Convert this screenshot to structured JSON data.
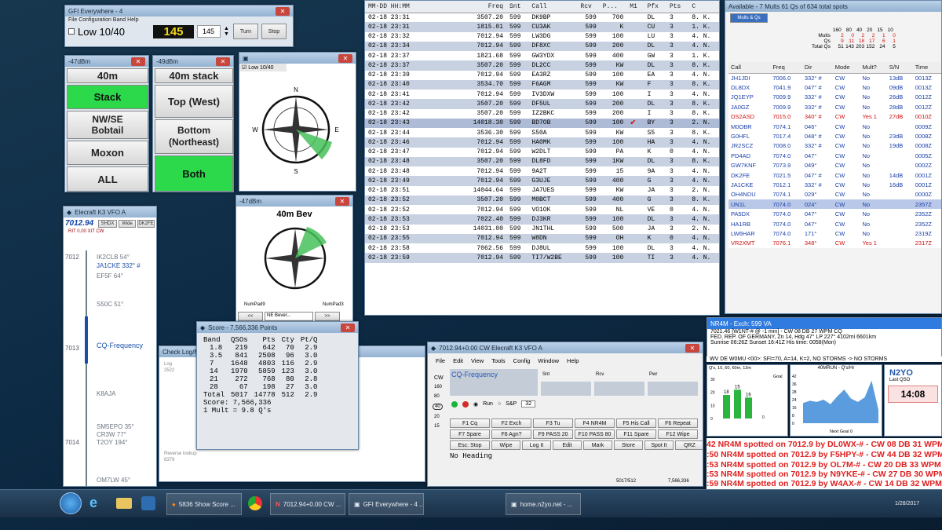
{
  "gfi": {
    "title": "GFI Everywhere - 4 ",
    "menu": "File  Configuration  Band  Help",
    "mode": "Low 10/40",
    "value": "145",
    "spin": "145",
    "turn": "Turn",
    "stop": "Stop"
  },
  "ant1": {
    "title": "-47dBm",
    "buttons": [
      "40m",
      "Stack",
      "NW/SE Bobtail",
      "Moxon",
      "ALL"
    ]
  },
  "ant2": {
    "title": "-49dBm",
    "buttons": [
      "40m stack",
      "Top (West)",
      "Bottom (Northeast)",
      "Both"
    ]
  },
  "rot1": {
    "checkbox": "Low 10/40",
    "compass": [
      "N",
      "E",
      "S",
      "W",
      "NE",
      "SE",
      "SW",
      "NW"
    ],
    "corner": "NE"
  },
  "rot2": {
    "title": "-47dBm",
    "heading": "40m Bev",
    "numpad9": "NumPad9",
    "numpad3": "NumPad3",
    "select": "NE Bever...",
    "prev": "<<",
    "next": ">>"
  },
  "bandmap": {
    "title": "Elecraft K3 VFO A",
    "freq": "7012.94",
    "opt1": "SHDX",
    "opt2": "Wide",
    "opt3": "DK2FE",
    "rit": "RIT  0.00  XIT  CW",
    "freqs": [
      "7012",
      "7013",
      "7014"
    ],
    "items": [
      "IK2CLB 54°",
      "JA1CKE 332° #",
      "EF5F 64°",
      "S50C 51°",
      "CQ-Frequency",
      "K8AJA",
      "SM5EPO 35°",
      "CR3W 77°",
      "T2OY 194°",
      "OM7LW 45°"
    ]
  },
  "log": {
    "columns": [
      "MM-DD HH:MM",
      "Freq",
      "Snt",
      "Call",
      "Rcv",
      "P...",
      "M1",
      "Pfx",
      "Pts",
      "C"
    ],
    "rows": [
      [
        "02-18 23:31",
        "3507.20",
        "599",
        "DK9BP",
        "599",
        "700",
        "",
        "DL",
        "3",
        "8. K."
      ],
      [
        "02-18 23:31",
        "1815.01",
        "599",
        "CU3AK",
        "599",
        "K",
        "",
        "CU",
        "3",
        "1. K."
      ],
      [
        "02-18 23:32",
        "7012.94",
        "599",
        "LW3DG",
        "599",
        "100",
        "",
        "LU",
        "3",
        "4. N."
      ],
      [
        "02-18 23:34",
        "7012.94",
        "599",
        "DF8XC",
        "599",
        "200",
        "",
        "DL",
        "3",
        "4. N."
      ],
      [
        "02-18 23:37",
        "1821.68",
        "599",
        "GW3YDX",
        "599",
        "400",
        "",
        "GW",
        "3",
        "1. K."
      ],
      [
        "02-18 23:37",
        "3507.20",
        "599",
        "DL2CC",
        "599",
        "KW",
        "",
        "DL",
        "3",
        "8. K."
      ],
      [
        "02-18 23:39",
        "7012.94",
        "599",
        "EA3RZ",
        "599",
        "100",
        "",
        "EA",
        "3",
        "4. N."
      ],
      [
        "02-18 23:40",
        "3534.70",
        "599",
        "F6AGM",
        "599",
        "KW",
        "",
        "F",
        "3",
        "8. K."
      ],
      [
        "02-18 23:41",
        "7012.94",
        "599",
        "IV3DXW",
        "599",
        "100",
        "",
        "I",
        "3",
        "4. N."
      ],
      [
        "02-18 23:42",
        "3507.20",
        "599",
        "DF5UL",
        "599",
        "200",
        "",
        "DL",
        "3",
        "8. K."
      ],
      [
        "02-18 23:42",
        "3507.20",
        "599",
        "IZ2BKC",
        "599",
        "200",
        "",
        "I",
        "3",
        "8. K."
      ],
      [
        "02-18 23:43",
        "14018.30",
        "599",
        "BD7OB",
        "599",
        "100",
        "✔",
        "BY",
        "3",
        "2. N."
      ],
      [
        "02-18 23:44",
        "3536.30",
        "599",
        "S50A",
        "599",
        "KW",
        "",
        "S5",
        "3",
        "8. K."
      ],
      [
        "02-18 23:46",
        "7012.94",
        "599",
        "HA0MK",
        "599",
        "100",
        "",
        "HA",
        "3",
        "4. N."
      ],
      [
        "02-18 23:47",
        "7012.94",
        "599",
        "W2DLT",
        "599",
        "PA",
        "",
        "K",
        "0",
        "4. N."
      ],
      [
        "02-18 23:48",
        "3507.20",
        "599",
        "DL8FD",
        "599",
        "1KW",
        "",
        "DL",
        "3",
        "8. K."
      ],
      [
        "02-18 23:48",
        "7012.94",
        "599",
        "9A2T",
        "599",
        "15",
        "",
        "9A",
        "3",
        "4. N."
      ],
      [
        "02-18 23:49",
        "7012.94",
        "599",
        "G3UJE",
        "599",
        "400",
        "",
        "G",
        "3",
        "4. N."
      ],
      [
        "02-18 23:51",
        "14044.64",
        "599",
        "JA7UES",
        "599",
        "KW",
        "",
        "JA",
        "3",
        "2. N."
      ],
      [
        "02-18 23:52",
        "3507.20",
        "599",
        "M0BCT",
        "599",
        "400",
        "",
        "G",
        "3",
        "8. K."
      ],
      [
        "02-18 23:52",
        "7012.94",
        "599",
        "VO1OK",
        "599",
        "NL",
        "",
        "VE",
        "0",
        "4. N."
      ],
      [
        "02-18 23:53",
        "7022.40",
        "599",
        "DJ3KR",
        "599",
        "100",
        "",
        "DL",
        "3",
        "4. N."
      ],
      [
        "02-18 23:53",
        "14031.00",
        "599",
        "JN1THL",
        "599",
        "500",
        "",
        "JA",
        "3",
        "2. N."
      ],
      [
        "02-18 23:55",
        "7012.94",
        "599",
        "W8DN",
        "599",
        "OH",
        "",
        "K",
        "0",
        "4. N."
      ],
      [
        "02-18 23:58",
        "7062.56",
        "599",
        "DJ8UL",
        "599",
        "100",
        "",
        "DL",
        "3",
        "4. N."
      ],
      [
        "02-18 23:59",
        "7012.94",
        "599",
        "TI7/W2BE",
        "599",
        "100",
        "",
        "TI",
        "3",
        "4. N."
      ]
    ]
  },
  "spots": {
    "title": "Available - 7 Mults 61 Qs of 634 total spots",
    "tab": "Mults & Qs",
    "grid_head": [
      "160",
      "80",
      "40",
      "20",
      "15",
      "10"
    ],
    "grid_rows": [
      {
        "label": "Mults",
        "vals": [
          "2",
          "0",
          "2",
          "2",
          "1",
          "0"
        ]
      },
      {
        "label": "Qs",
        "vals": [
          "9",
          "11",
          "18",
          "17",
          "6",
          "1"
        ]
      },
      {
        "label": "Total Qs",
        "vals": [
          "51",
          "143",
          "203",
          "152",
          "24",
          "5"
        ]
      }
    ],
    "columns": [
      "Call",
      "Freq",
      "Dir",
      "Mode",
      "Mult?",
      "S/N",
      "Time"
    ],
    "rows": [
      [
        "JH1JDI",
        "7006.0",
        "332° #",
        "CW",
        "No",
        "13dB",
        "0013Z"
      ],
      [
        "DL8DX",
        "7041.9",
        "047° #",
        "CW",
        "No",
        "09dB",
        "0013Z"
      ],
      [
        "JQ1EYP",
        "7009.9",
        "332° #",
        "CW",
        "No",
        "26dB",
        "0012Z"
      ],
      [
        "JA0GZ",
        "7009.9",
        "332° #",
        "CW",
        "No",
        "28dB",
        "0012Z"
      ],
      [
        "DS2ASD",
        "7015.0",
        "340° #",
        "CW",
        "Yes 1",
        "27dB",
        "0010Z"
      ],
      [
        "M0OBR",
        "7074.1",
        "046°",
        "CW",
        "No",
        "",
        "0009Z"
      ],
      [
        "G0HFL",
        "7017.4",
        "048° #",
        "CW",
        "No",
        "23dB",
        "0008Z"
      ],
      [
        "JR2SCZ",
        "7008.0",
        "332° #",
        "CW",
        "No",
        "19dB",
        "0008Z"
      ],
      [
        "PD4AD",
        "7074.0",
        "047°",
        "CW",
        "No",
        "",
        "0005Z"
      ],
      [
        "GW7KNF",
        "7073.9",
        "049°",
        "CW",
        "No",
        "",
        "0002Z"
      ],
      [
        "DK2FE",
        "7021.5",
        "047° #",
        "CW",
        "No",
        "14dB",
        "0001Z"
      ],
      [
        "JA1CKE",
        "7012.1",
        "332° #",
        "CW",
        "No",
        "16dB",
        "0001Z"
      ],
      [
        "OH4NDU",
        "7074.1",
        "029°",
        "CW",
        "No",
        "",
        "0000Z"
      ],
      [
        "UN1L",
        "7074.0",
        "024°",
        "CW",
        "No",
        "",
        "2357Z"
      ],
      [
        "PA5DX",
        "7074.0",
        "047°",
        "CW",
        "No",
        "",
        "2352Z"
      ],
      [
        "HA1RB",
        "7074.0",
        "047°",
        "CW",
        "No",
        "",
        "2352Z"
      ],
      [
        "LW6HAR",
        "7074.0",
        "171°",
        "CW",
        "No",
        "",
        "2319Z"
      ],
      [
        "VR2XMT",
        "7076.1",
        "348°",
        "CW",
        "Yes 1",
        "",
        "2317Z"
      ]
    ]
  },
  "score": {
    "title": "Score - 7,566,336 Points",
    "columns": [
      "Band",
      "QSOs",
      "Pts",
      "Cty",
      "Pt/Q"
    ],
    "rows": [
      [
        "1.8",
        "219",
        "642",
        "70",
        "2.9"
      ],
      [
        "3.5",
        "841",
        "2508",
        "96",
        "3.0"
      ],
      [
        "7",
        "1648",
        "4803",
        "116",
        "2.9"
      ],
      [
        "14",
        "1970",
        "5859",
        "123",
        "3.0"
      ],
      [
        "21",
        "272",
        "768",
        "80",
        "2.8"
      ],
      [
        "28",
        "67",
        "198",
        "27",
        "3.0"
      ],
      [
        "Total",
        "5017",
        "14778",
        "512",
        "2.9"
      ]
    ],
    "summary": "Score: 7,566,336",
    "mult": "1 Mult = 9.8 Q's"
  },
  "checklog": {
    "title": "Check Log/Ma",
    "log": "Log",
    "count": "2522",
    "reverse": "Reverse lookup",
    "rcount": "8379"
  },
  "entry": {
    "title": "7012.94+0.00 CW Elecraft K3 VFO A",
    "menu": [
      "File",
      "Edit",
      "View",
      "Tools",
      "Config",
      "Window",
      "Help"
    ],
    "callsign": "CQ-Frequency",
    "snt_label": "Snt",
    "rcv_label": "Rcv",
    "pwr_label": "Pwr",
    "bands": [
      "160",
      "80",
      "40",
      "20",
      "15"
    ],
    "cw": "CW",
    "run": "Run",
    "sp": "S&P",
    "spin": "32",
    "fkeys": [
      "F1 Cq",
      "F2 Exch",
      "F3 Tu",
      "F4 NR4M",
      "F5 His Call",
      "F6 Repeat",
      "F7 Spare",
      "F8 Agn?",
      "F9 PASS 20",
      "F10 PASS 80",
      "F11 Spare",
      "F12 Wipe",
      "Esc: Stop",
      "Wipe",
      "Log It",
      "Edit",
      "Mark",
      "Store",
      "Spot It",
      "QRZ"
    ],
    "heading": "No Heading",
    "status1": "5017/512",
    "status2": "7,566,336"
  },
  "cluster": {
    "title": "NR4M - Exch: 599 VA",
    "line1": "7021.46 [W1NT-# @ -1 min] - CW 08 DB 27 WPM CQ",
    "line2": "FED. REP. OF GERMANY, Zn 14, Hdg 47° LP 227° 4102mi 6601km",
    "line3": "Sunrise 06:26Z Sunset 16:41Z His time: 0058(Mon)",
    "line4": "WV DE W0MU <00>:  SFI=70, A=14, K=2, NO STORMS -> NO STORMS"
  },
  "rate1": {
    "label": "Goal",
    "legend": "Q's, 10, 60, 60m, 13m",
    "ticks": [
      "30",
      "20",
      "10",
      "0"
    ],
    "bars": [
      {
        "label": "18",
        "value": 18
      },
      {
        "label": "15",
        "value": 22
      },
      {
        "label": "16",
        "value": 16
      }
    ]
  },
  "rate2": {
    "title": "40MRUN - Q's/Hr",
    "ticks": [
      "42",
      "36",
      "28",
      "24",
      "16",
      "8",
      "0"
    ],
    "next": "Next Goal 0",
    "series": [
      18,
      20,
      19,
      21,
      17,
      24,
      30,
      22,
      19,
      23,
      38,
      12
    ]
  },
  "n2yo": {
    "call": "N2YO",
    "last": "Last QSO",
    "time": "14:08"
  },
  "spotlines": [
    "42 NR4M spotted on 7012.9 by DL0WX-# - CW 08 DB 31 WPM",
    ":50 NR4M spotted on 7012.9 by F5HPY-# - CW 44 DB 32 WPM C",
    ":53 NR4M spotted on 7012.9 by OL7M-# - CW 20 DB 33 WPM C",
    ":53 NR4M spotted on 7012.9 by N9YKE-# - CW 27 DB 30 WPM C",
    ":59 NR4M spotted on 7012.9 by W4AX-# - CW 14 DB 32 WPM C"
  ],
  "taskbar": {
    "items": [
      "5836 Show Score ...",
      "7012.94+0.00 CW ...",
      "GFI Everywhere - 4 ...",
      "home.n2yo.net - ..."
    ],
    "clock": "1/28/2017"
  },
  "colors": {
    "accent_green": "#2bd94a",
    "spot_red": "#e02020",
    "log_blue": "#c7d1e2"
  }
}
